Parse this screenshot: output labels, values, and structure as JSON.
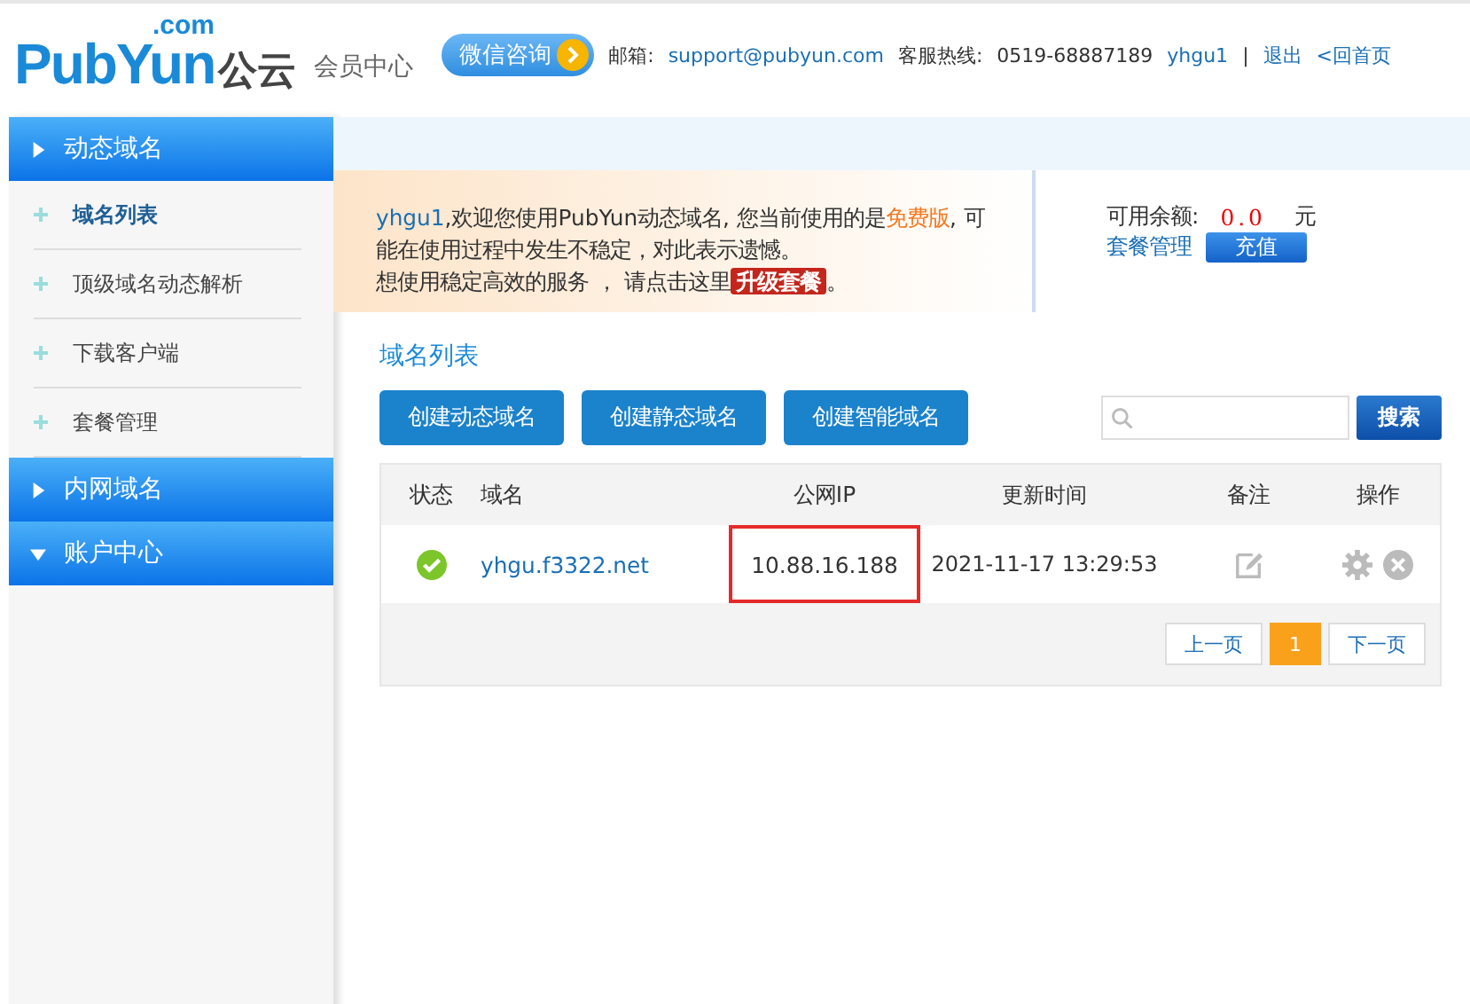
{
  "header": {
    "logo": {
      "dotcom": ".com",
      "name": "PubYun",
      "cn": "公云"
    },
    "subtitle": "会员中心",
    "wechat_button": "微信咨询",
    "email_label": "邮箱:",
    "email": "support@pubyun.com",
    "hotline_label": "客服热线:",
    "hotline": "0519-68887189",
    "user": "yhgu1",
    "separator": "|",
    "logout": "退出",
    "home": "<回首页"
  },
  "sidebar": [
    {
      "label": "动态域名",
      "expanded": false,
      "items": [
        {
          "label": "域名列表",
          "selected": true
        },
        {
          "label": "顶级域名动态解析",
          "selected": false
        },
        {
          "label": "下载客户端",
          "selected": false
        },
        {
          "label": "套餐管理",
          "selected": false
        }
      ]
    },
    {
      "label": "内网域名",
      "expanded": false
    },
    {
      "label": "账户中心",
      "expanded": true
    }
  ],
  "notice": {
    "user": "yhgu1",
    "text1": ",欢迎您使用PubYun动态域名, 您当前使用的是",
    "plan": "免费版",
    "text2": ",  可能在使用过程中发生不稳定，对此表示遗憾。",
    "text3": "想使用稳定高效的服务 ， 请点击这里",
    "upgrade": "升级套餐",
    "end": "。"
  },
  "balance": {
    "label": "可用余额:",
    "amount": "0.0",
    "unit": "元",
    "manage": "套餐管理",
    "recharge": "充值"
  },
  "section_title": "域名列表",
  "actions": [
    "创建动态域名",
    "创建静态域名",
    "创建智能域名"
  ],
  "search": {
    "button": "搜索"
  },
  "table": {
    "columns": [
      "状态",
      "域名",
      "公网IP",
      "更新时间",
      "备注",
      "操作"
    ],
    "rows": [
      {
        "verified": true,
        "domain": "yhgu.f3322.net",
        "ip": "10.88.16.188",
        "ip_highlighted": true,
        "updated": "2021-11-17 13:29:53"
      }
    ]
  },
  "pagination": {
    "prev": "上一页",
    "pages": [
      {
        "label": "1",
        "selected": true
      }
    ],
    "next": "下一页"
  }
}
